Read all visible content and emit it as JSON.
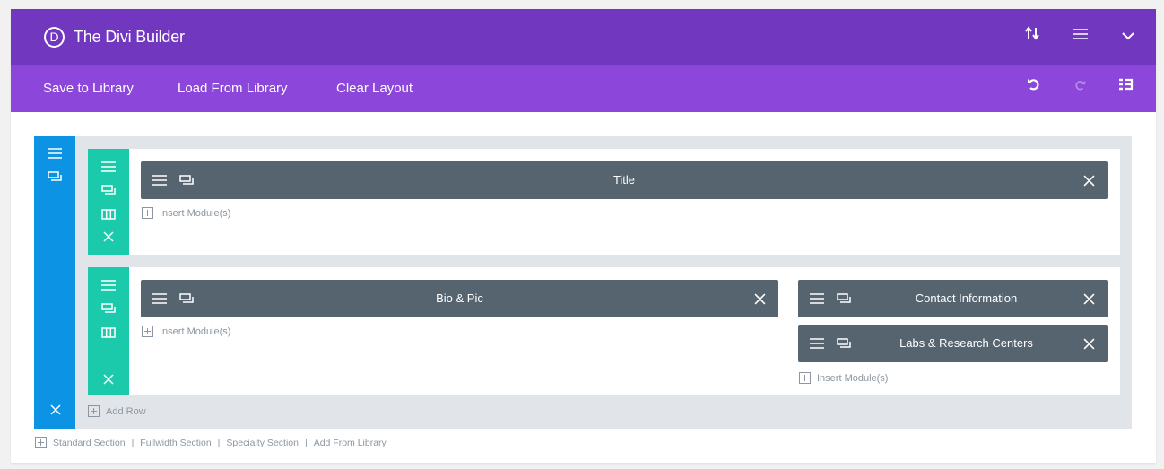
{
  "header": {
    "logo_letter": "D",
    "title": "The Divi Builder",
    "icons": [
      "sort-arrows-icon",
      "hamburger-icon",
      "chevron-down-icon"
    ]
  },
  "toolbar": {
    "save_to_library": "Save to Library",
    "load_from_library": "Load From Library",
    "clear_layout": "Clear Layout",
    "icons": [
      "undo-icon",
      "redo-icon",
      "history-icon"
    ]
  },
  "rows": [
    {
      "columns": [
        {
          "modules": [
            {
              "title": "Title"
            }
          ],
          "insert_label": "Insert Module(s)"
        }
      ]
    },
    {
      "columns": [
        {
          "modules": [
            {
              "title": "Bio & Pic"
            }
          ],
          "insert_label": "Insert Module(s)"
        },
        {
          "modules": [
            {
              "title": "Contact Information"
            },
            {
              "title": "Labs & Research Centers"
            }
          ],
          "insert_label": "Insert Module(s)"
        }
      ]
    }
  ],
  "section": {
    "add_row": "Add Row"
  },
  "footer": {
    "standard_section": "Standard Section",
    "fullwidth_section": "Fullwidth Section",
    "specialty_section": "Specialty Section",
    "add_from_library": "Add From Library",
    "separator": "|"
  },
  "colors": {
    "header": "#7237bf",
    "toolbar": "#8c46d9",
    "section_sidebar": "#0c93e3",
    "row_sidebar": "#1bcaaa",
    "module": "#566470",
    "section_bg": "#e1e5e9"
  }
}
